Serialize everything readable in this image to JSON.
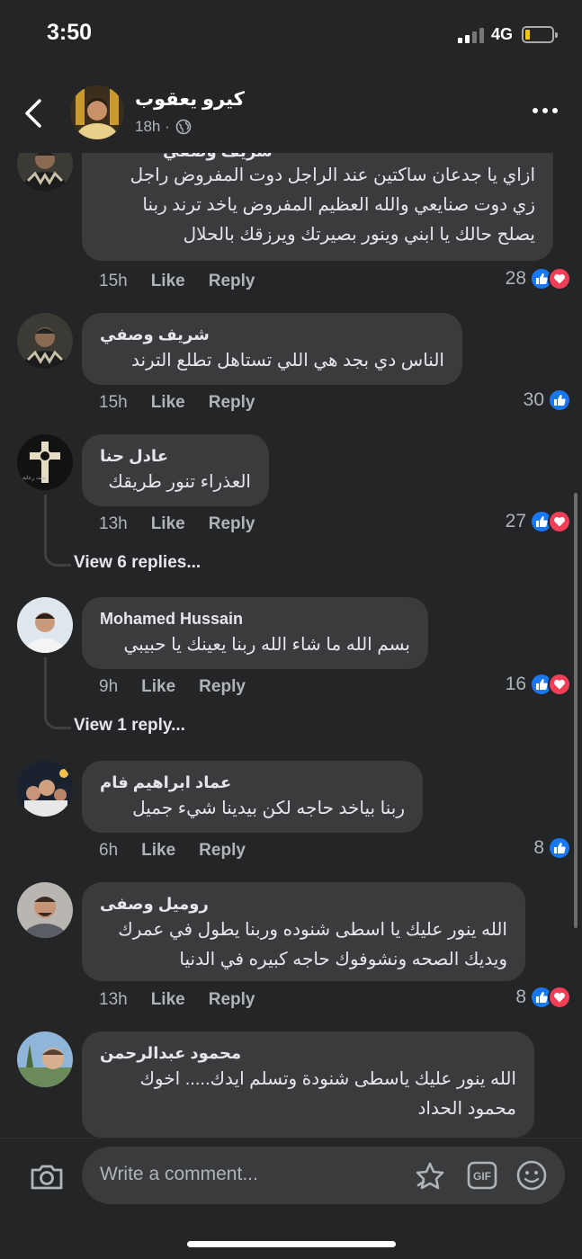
{
  "status": {
    "time": "3:50",
    "network": "4G"
  },
  "post": {
    "author": "كيرو يعقوب",
    "age": "18h ·"
  },
  "comments": [
    {
      "author": "شريف وصفي",
      "lines": [
        "ازاي يا جدعان ساكتين عند الراجل دوت المفروض راجل",
        "زي دوت صنايعي والله العظيم المفروض ياخد ترند ربنا",
        "يصلح حالك يا ابني وينور بصيرتك ويرزقك بالحلال"
      ],
      "time": "15h",
      "like": "Like",
      "reply": "Reply",
      "count": "28",
      "reactions": [
        "like",
        "love"
      ]
    },
    {
      "author": "شريف وصفي",
      "lines": [
        "الناس دي بجد هي اللي تستاهل تطلع الترند"
      ],
      "time": "15h",
      "like": "Like",
      "reply": "Reply",
      "count": "30",
      "reactions": [
        "like"
      ]
    },
    {
      "author": "عادل حنا",
      "lines": [
        "العذراء تنور طريقك"
      ],
      "time": "13h",
      "like": "Like",
      "reply": "Reply",
      "count": "27",
      "reactions": [
        "like",
        "love"
      ],
      "view_replies": "View 6 replies..."
    },
    {
      "author": "Mohamed Hussain",
      "lines": [
        "بسم الله ما شاء الله ربنا يعينك يا حبيبي"
      ],
      "time": "9h",
      "like": "Like",
      "reply": "Reply",
      "count": "16",
      "reactions": [
        "like",
        "love"
      ],
      "view_replies": "View 1 reply..."
    },
    {
      "author": "عماد ابراهيم فام",
      "lines": [
        "ربنا بياخد حاجه لكن بيدينا شيء جميل"
      ],
      "time": "6h",
      "like": "Like",
      "reply": "Reply",
      "count": "8",
      "reactions": [
        "like"
      ]
    },
    {
      "author": "روميل وصفى",
      "lines": [
        "الله ينور عليك يا اسطى شنوده وربنا يطول في عمرك",
        "ويديك الصحه ونشوفوك حاجه كبيره في الدنيا"
      ],
      "time": "13h",
      "like": "Like",
      "reply": "Reply",
      "count": "8",
      "reactions": [
        "like",
        "love"
      ]
    },
    {
      "author": "محمود عبدالرحمن",
      "lines": [
        "الله ينور عليك ياسطى شنودة وتسلم ايدك..... اخوك",
        "محمود الحداد"
      ]
    }
  ],
  "composer": {
    "placeholder": "Write a comment...",
    "gif": "GIF"
  },
  "colors": {
    "background": "#242526",
    "bubble": "#3a3b3c",
    "like": "#1877f2",
    "love": "#f33e58",
    "muted": "#b0b3b8"
  }
}
